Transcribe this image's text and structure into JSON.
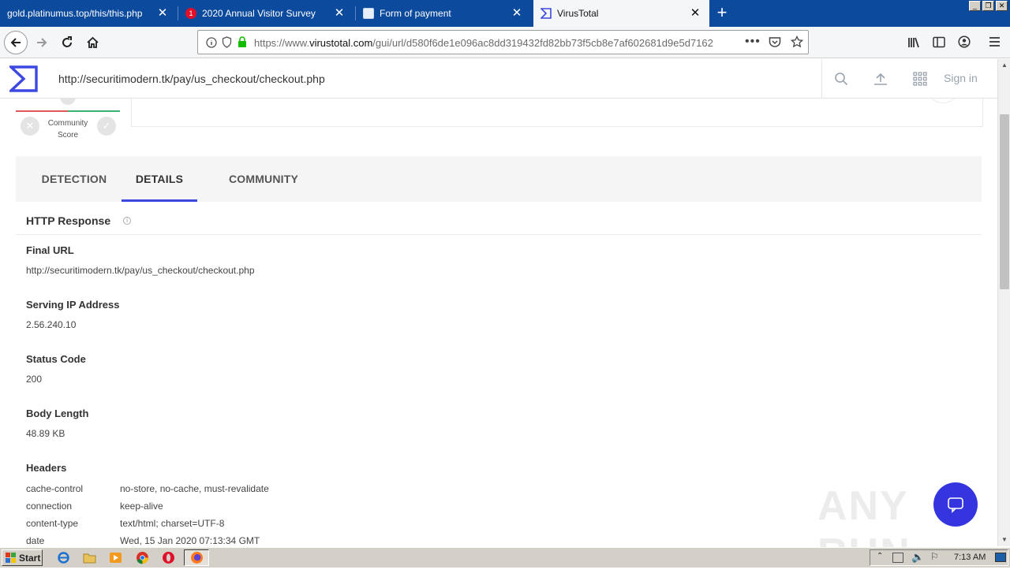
{
  "browser": {
    "tabs": [
      {
        "title": "gold.platinumus.top/this/this.php",
        "active": false
      },
      {
        "title": "2020 Annual Visitor Survey",
        "active": false,
        "badge": "1"
      },
      {
        "title": "Form of payment",
        "active": false
      },
      {
        "title": "VirusTotal",
        "active": true
      }
    ],
    "url_prefix": "https://www.",
    "url_domain": "virustotal.com",
    "url_rest": "/gui/url/d580f6de1e096ac8dd319432fd82bb73f5cb8e7af602681d9e5d7162"
  },
  "vt": {
    "search_value": "http://securitimodern.tk/pay/us_checkout/checkout.php",
    "signin_label": "Sign in",
    "community_label_1": "Community",
    "community_label_2": "Score",
    "tabs": [
      "DETECTION",
      "DETAILS",
      "COMMUNITY"
    ],
    "active_tab": "DETAILS",
    "section_title": "HTTP Response",
    "fields": {
      "final_url_label": "Final URL",
      "final_url_value": "http://securitimodern.tk/pay/us_checkout/checkout.php",
      "ip_label": "Serving IP Address",
      "ip_value": "2.56.240.10",
      "status_label": "Status Code",
      "status_value": "200",
      "body_label": "Body Length",
      "body_value": "48.89 KB",
      "headers_label": "Headers"
    },
    "headers": [
      {
        "key": "cache-control",
        "value": "no-store, no-cache, must-revalidate"
      },
      {
        "key": "connection",
        "value": "keep-alive"
      },
      {
        "key": "content-type",
        "value": "text/html; charset=UTF-8"
      },
      {
        "key": "date",
        "value": "Wed, 15 Jan 2020 07:13:34 GMT"
      }
    ]
  },
  "watermark": "ANY RUN",
  "taskbar": {
    "start_label": "Start",
    "clock": "7:13 AM"
  },
  "colors": {
    "tabbar": "#0c4a9e",
    "vt_accent": "#3c48e2",
    "chat_button": "#3535e0"
  }
}
